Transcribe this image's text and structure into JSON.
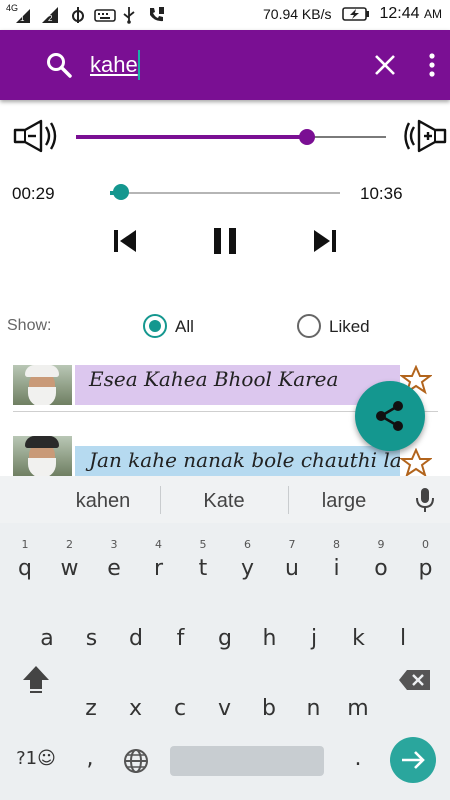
{
  "status_bar": {
    "network_label": "4G",
    "sim1": "1",
    "sim2": "2",
    "speed": "70.94 KB/s",
    "time": "12:44",
    "ampm": "AM"
  },
  "search": {
    "query": "kahe"
  },
  "player": {
    "volume_fraction": 0.745,
    "current_time": "00:29",
    "total_time": "10:36",
    "progress_fraction": 0.046
  },
  "filter": {
    "label": "Show:",
    "options": [
      {
        "label": "All",
        "selected": true
      },
      {
        "label": "Liked",
        "selected": false
      }
    ]
  },
  "tracks": [
    {
      "title": "Esea Kahea Bhool Karea",
      "background": "#dcc7ee",
      "turban": "#f0f0ee",
      "starred": false
    },
    {
      "title": "Jan kahe nanak bole chauthi la...",
      "background": "#b6daf0",
      "turban": "#2a2a2a",
      "starred": false
    }
  ],
  "keyboard": {
    "suggestions": [
      "kahen",
      "Kate",
      "large"
    ],
    "row1": [
      {
        "key": "q",
        "hint": "1"
      },
      {
        "key": "w",
        "hint": "2"
      },
      {
        "key": "e",
        "hint": "3"
      },
      {
        "key": "r",
        "hint": "4"
      },
      {
        "key": "t",
        "hint": "5"
      },
      {
        "key": "y",
        "hint": "6"
      },
      {
        "key": "u",
        "hint": "7"
      },
      {
        "key": "i",
        "hint": "8"
      },
      {
        "key": "o",
        "hint": "9"
      },
      {
        "key": "p",
        "hint": "0"
      }
    ],
    "row2": [
      "a",
      "s",
      "d",
      "f",
      "g",
      "h",
      "j",
      "k",
      "l"
    ],
    "row3": [
      "z",
      "x",
      "c",
      "v",
      "b",
      "n",
      "m"
    ],
    "symbols_key": "?1☺",
    "comma_key": ",",
    "period_key": "."
  },
  "colors": {
    "appbar": "#7a0f93",
    "accent": "#14978f"
  }
}
